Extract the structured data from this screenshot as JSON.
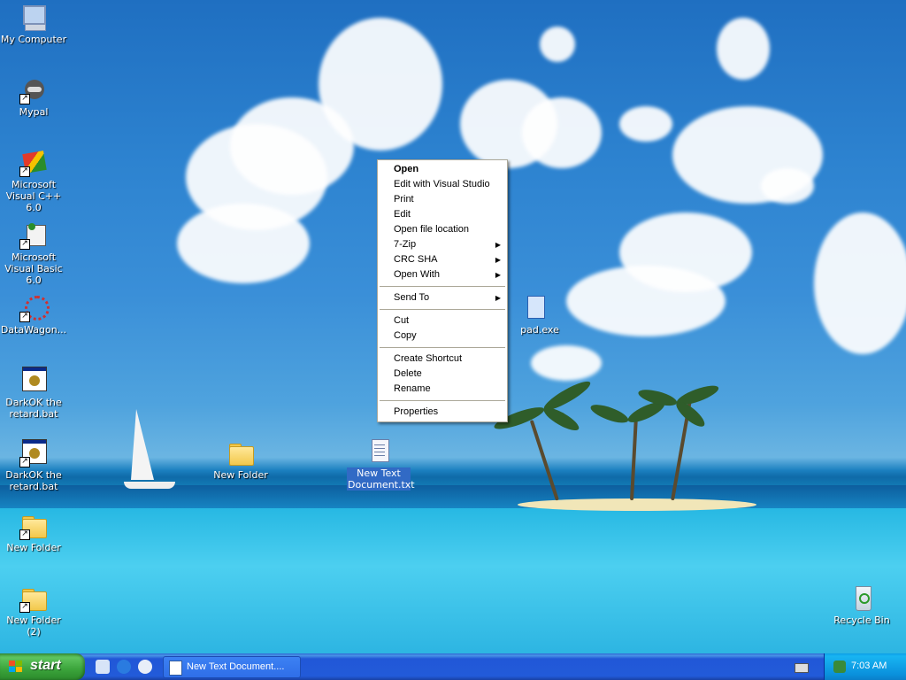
{
  "desktop": {
    "icons": [
      {
        "label": "My Computer",
        "icon": "my-computer-icon"
      },
      {
        "label": "Mypal",
        "icon": "raccoon-browser-icon"
      },
      {
        "label": "Microsoft Visual C++ 6.0",
        "icon": "visual-cpp-icon"
      },
      {
        "label": "Microsoft Visual Basic 6.0",
        "icon": "visual-basic-icon"
      },
      {
        "label": "DataWagon...",
        "icon": "datawagon-icon"
      },
      {
        "label": "DarkOK the retard.bat",
        "icon": "batch-file-icon"
      },
      {
        "label": "DarkOK the retard.bat",
        "icon": "batch-file-icon"
      },
      {
        "label": "New Folder",
        "icon": "folder-icon"
      },
      {
        "label": "New Folder (2)",
        "icon": "folder-icon"
      },
      {
        "label": "New Folder",
        "icon": "folder-icon"
      },
      {
        "label": "New Text Document.txt",
        "icon": "text-document-icon"
      },
      {
        "label": "pad.exe",
        "icon": "notepad-icon"
      },
      {
        "label": "Recycle Bin",
        "icon": "recycle-bin-icon"
      }
    ]
  },
  "context_menu": {
    "items": [
      {
        "label": "Open"
      },
      {
        "label": "Edit with Visual Studio"
      },
      {
        "label": "Print"
      },
      {
        "label": "Edit"
      },
      {
        "label": "Open file location"
      },
      {
        "label": "7-Zip"
      },
      {
        "label": "CRC SHA"
      },
      {
        "label": "Open With"
      },
      {
        "label": "Send To"
      },
      {
        "label": "Cut"
      },
      {
        "label": "Copy"
      },
      {
        "label": "Create Shortcut"
      },
      {
        "label": "Delete"
      },
      {
        "label": "Rename"
      },
      {
        "label": "Properties"
      }
    ]
  },
  "taskbar": {
    "start_label": "start",
    "task_button_label": "New Text Document....",
    "clock": "7:03 AM"
  }
}
